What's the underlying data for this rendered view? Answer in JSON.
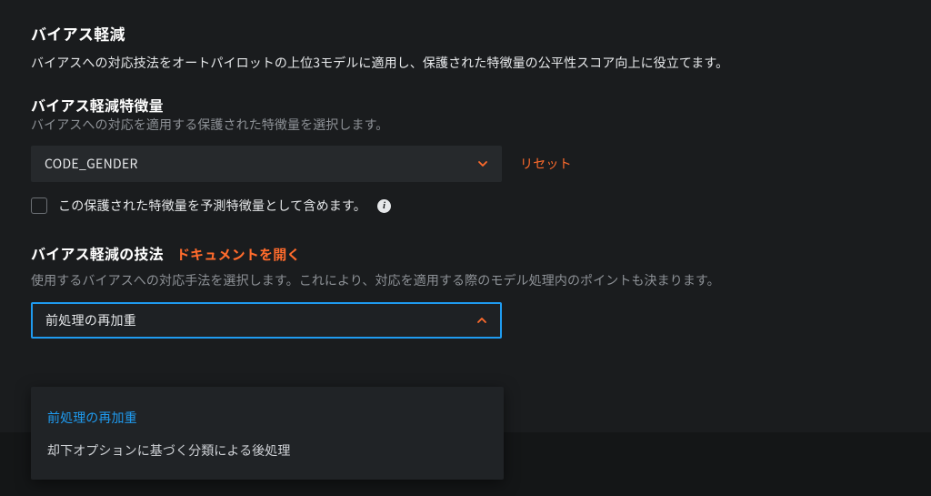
{
  "header": {
    "title": "バイアス軽減",
    "description": "バイアスへの対応技法をオートパイロットの上位3モデルに適用し、保護された特徴量の公平性スコア向上に役立てます。"
  },
  "feature_field": {
    "title": "バイアス軽減特徴量",
    "description": "バイアスへの対応を適用する保護された特徴量を選択します。",
    "selected": "CODE_GENDER",
    "reset_label": "リセット"
  },
  "include_checkbox": {
    "label": "この保護された特徴量を予測特徴量として含めます。"
  },
  "technique_field": {
    "title": "バイアス軽減の技法",
    "doc_link": "ドキュメントを開く",
    "description": "使用するバイアスへの対応手法を選択します。これにより、対応を適用する際のモデル処理内のポイントも決まります。",
    "selected": "前処理の再加重",
    "options": [
      "前処理の再加重",
      "却下オプションに基づく分類による後処理"
    ]
  }
}
